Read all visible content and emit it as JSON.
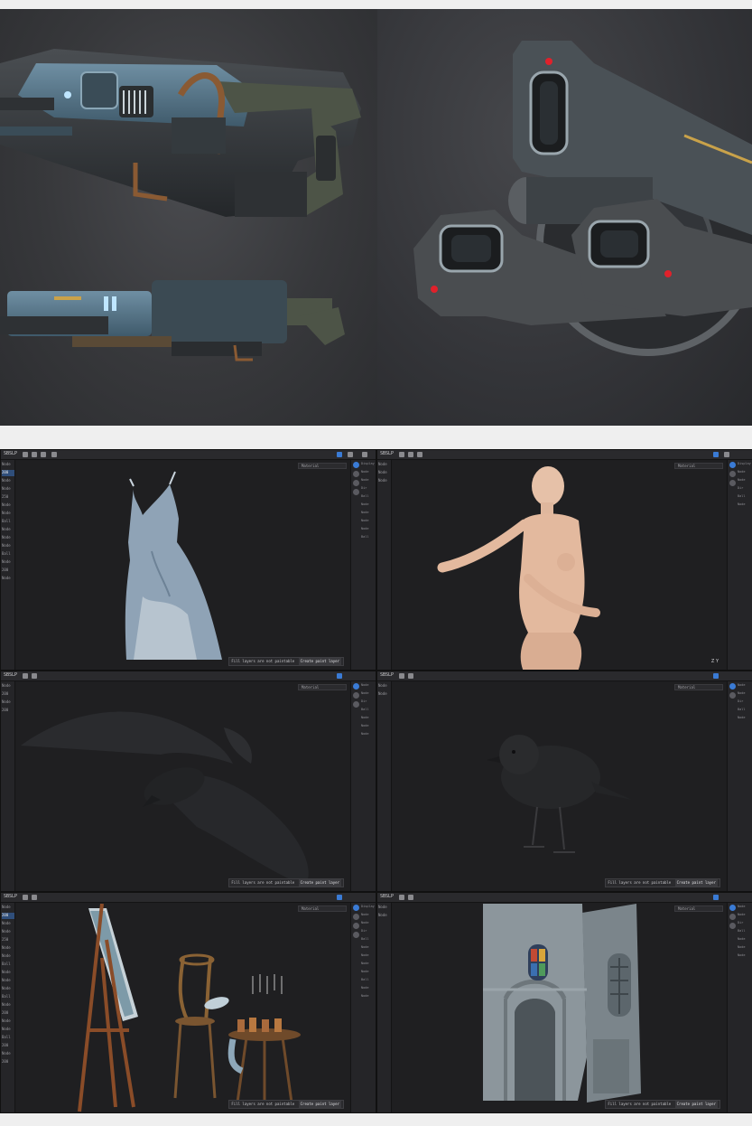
{
  "render_panel": {
    "left_view": "weapon-side-views",
    "right_view": "weapon-barrels-closeup",
    "colors": {
      "metal_blue": "#5b7d93",
      "dark_metal": "#2e3134",
      "olive": "#4d5447",
      "copper": "#8a5a33",
      "glow": "#bfe6ff",
      "red_light": "#e0212b"
    }
  },
  "app": {
    "name": "SBSLP",
    "material_label": "Material",
    "warning_text": "Fill layers are not paintable",
    "create_button": "Create paint layer",
    "axis_label_z": "Z",
    "axis_label_y": "Y",
    "left_labels": [
      "Node",
      "200",
      "Node",
      "Node",
      "250",
      "Node",
      "Node",
      "Ball",
      "Node",
      "Node",
      "Node",
      "Ball",
      "Node",
      "200",
      "Node",
      "Node",
      "Ball",
      "200",
      "Node",
      "200"
    ],
    "right_labels": [
      "Display",
      "Node",
      "Node",
      "Dir",
      "Ball",
      "Node",
      "Node",
      "Node",
      "Node",
      "Ball",
      "Node",
      "Node",
      "Ball",
      "Node",
      "Node",
      "Node"
    ],
    "colors": {
      "accent": "#3a7bd5",
      "bg": "#1f1f21",
      "panel": "#252528"
    }
  },
  "windows": [
    {
      "subject": "dress-model",
      "show_warning": true,
      "show_axes": false
    },
    {
      "subject": "female-figure-model",
      "show_warning": false,
      "show_axes": true
    },
    {
      "subject": "crow-flying-model",
      "show_warning": true,
      "show_axes": false
    },
    {
      "subject": "sparrow-model",
      "show_warning": true,
      "show_axes": false
    },
    {
      "subject": "easel-chairs-scene",
      "show_warning": true,
      "show_axes": false
    },
    {
      "subject": "gothic-interior-scene",
      "show_warning": true,
      "show_axes": false
    }
  ]
}
